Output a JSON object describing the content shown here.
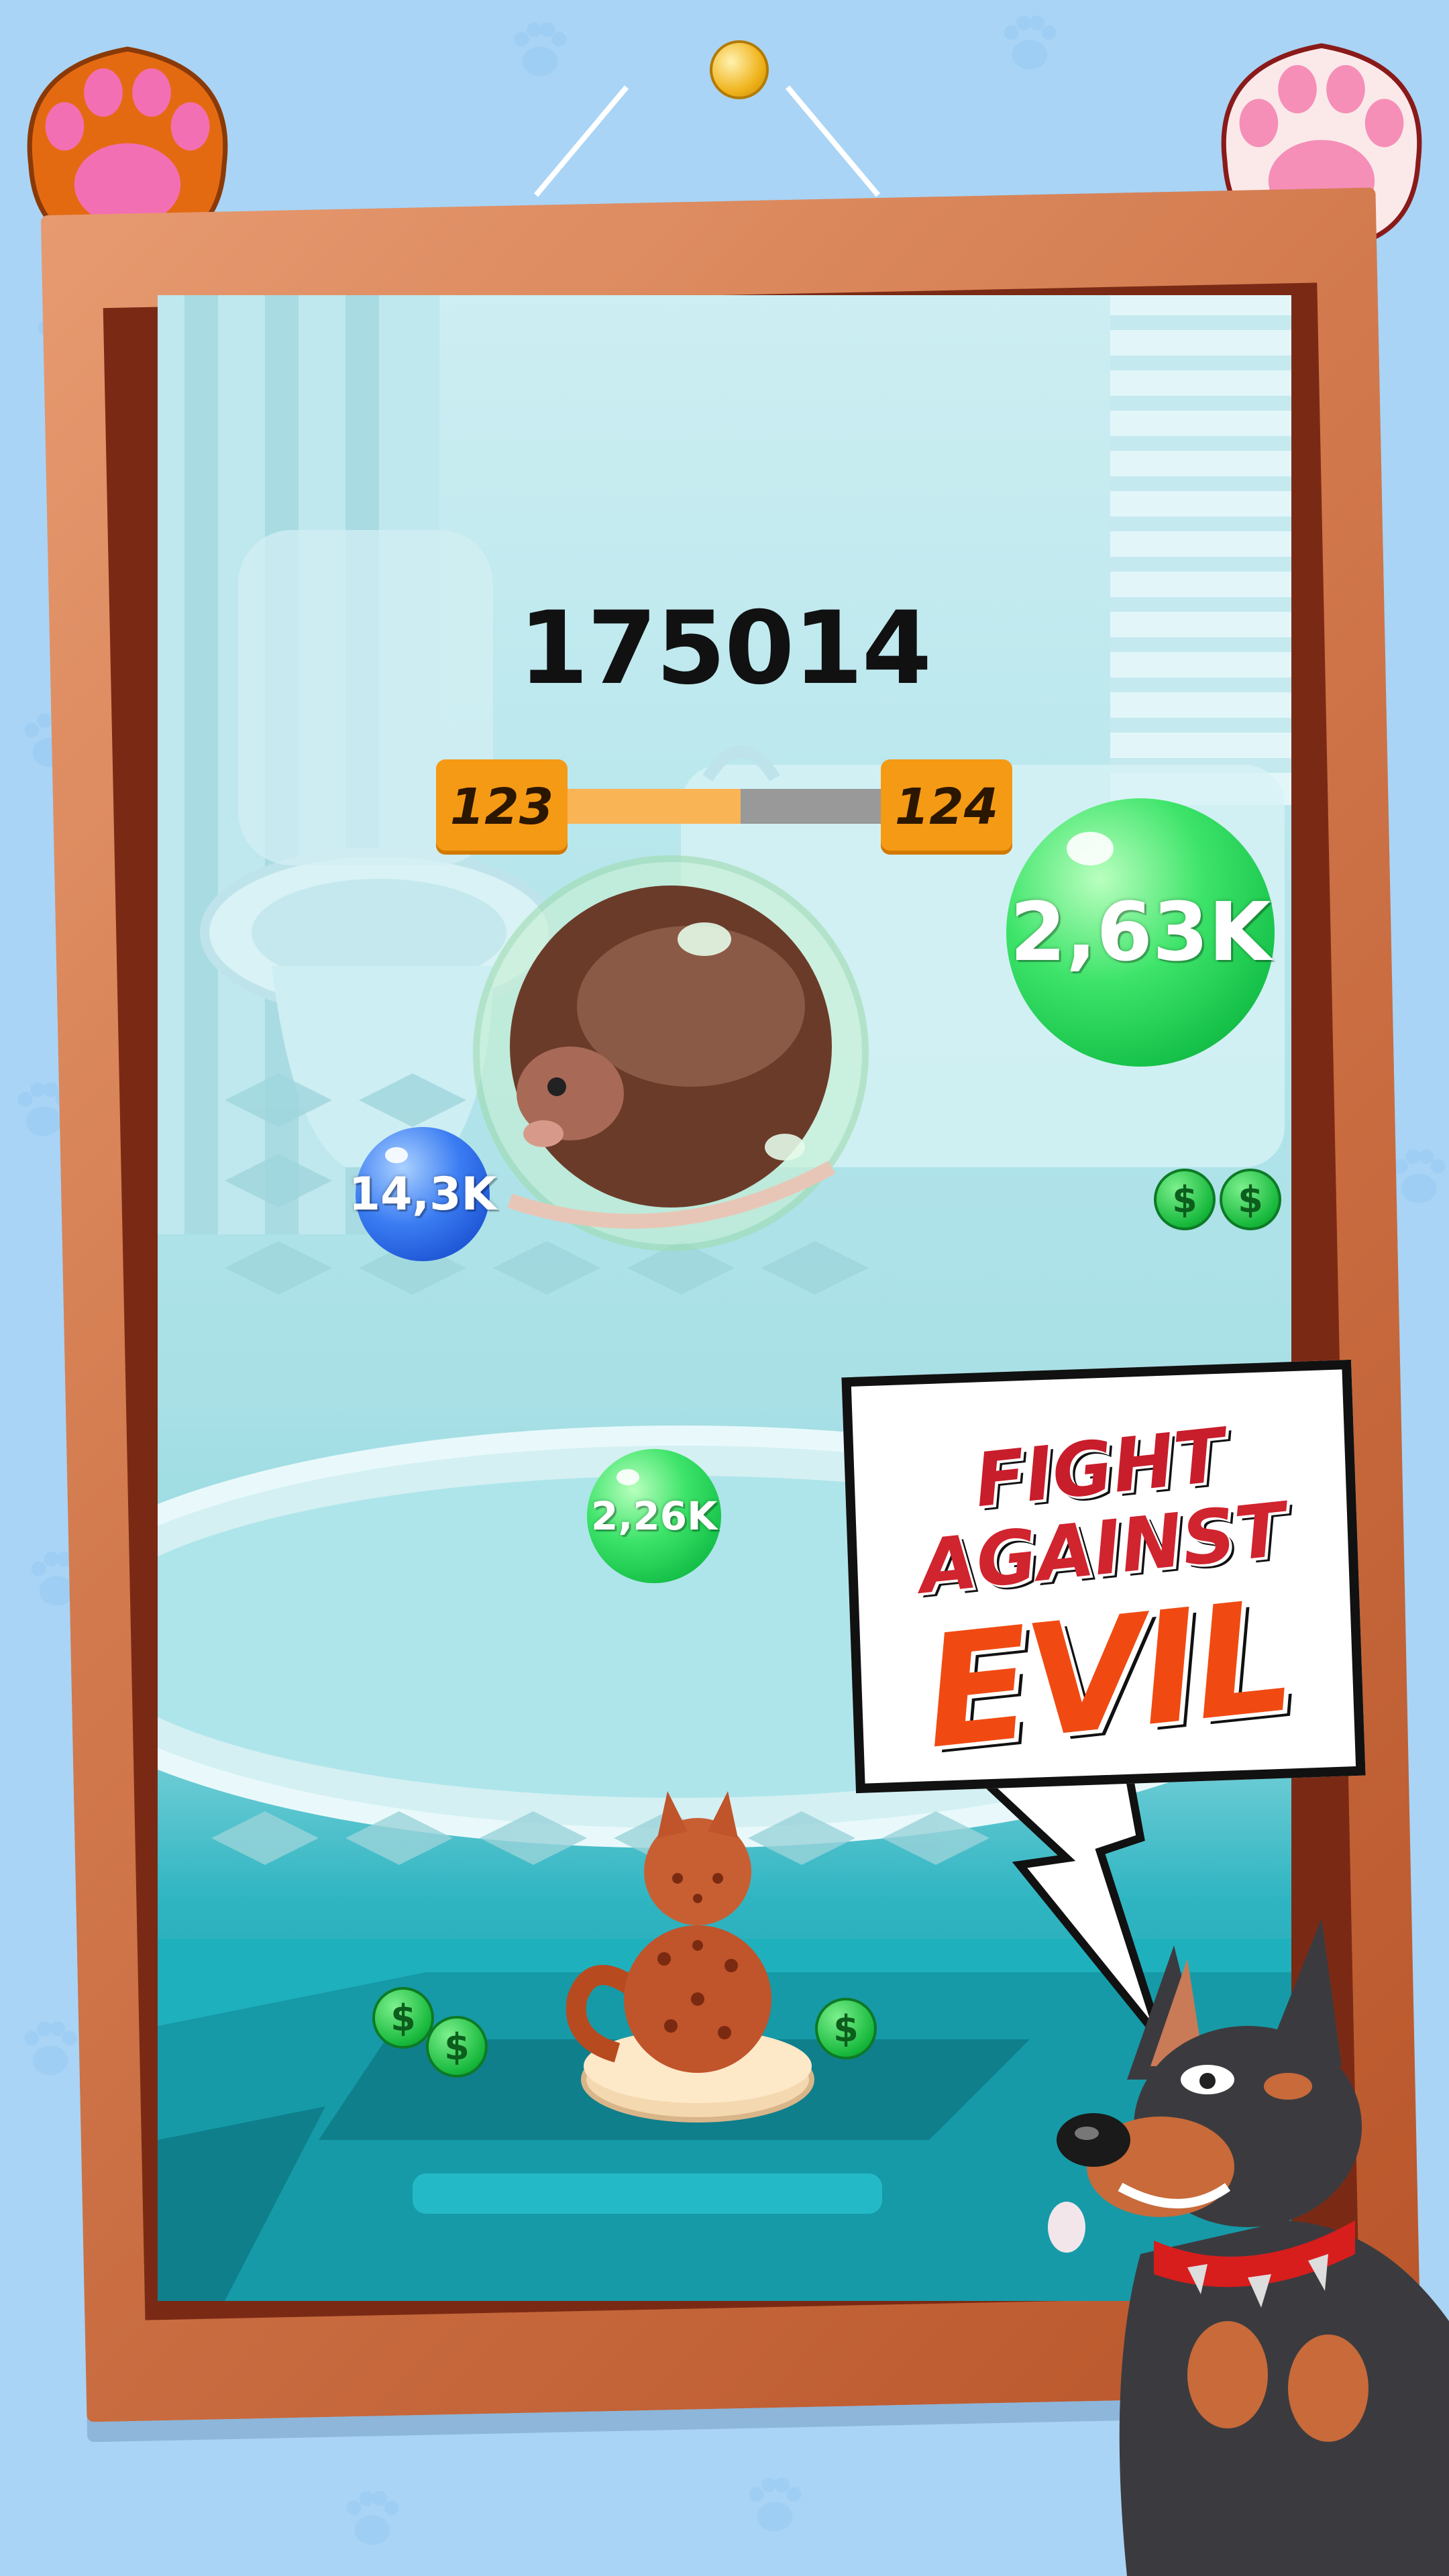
{
  "score": "175014",
  "level": {
    "current": "123",
    "next": "124",
    "progress": 0.55
  },
  "bubbles": [
    {
      "id": "big",
      "label": "2,63K",
      "color": "#22d655"
    },
    {
      "id": "small-blue",
      "label": "14,3K",
      "color": "#2a66e8"
    },
    {
      "id": "small-green",
      "label": "2,26K",
      "color": "#22d655"
    }
  ],
  "coin_symbol": "$",
  "speech": {
    "line1": "FIGHT",
    "line2": "AGAINST",
    "line3": "EVIL"
  },
  "colors": {
    "background": "#a9d4f5",
    "frame": "#d27a4e",
    "level_badge": "#f59a15",
    "evil": "#f04a12"
  }
}
